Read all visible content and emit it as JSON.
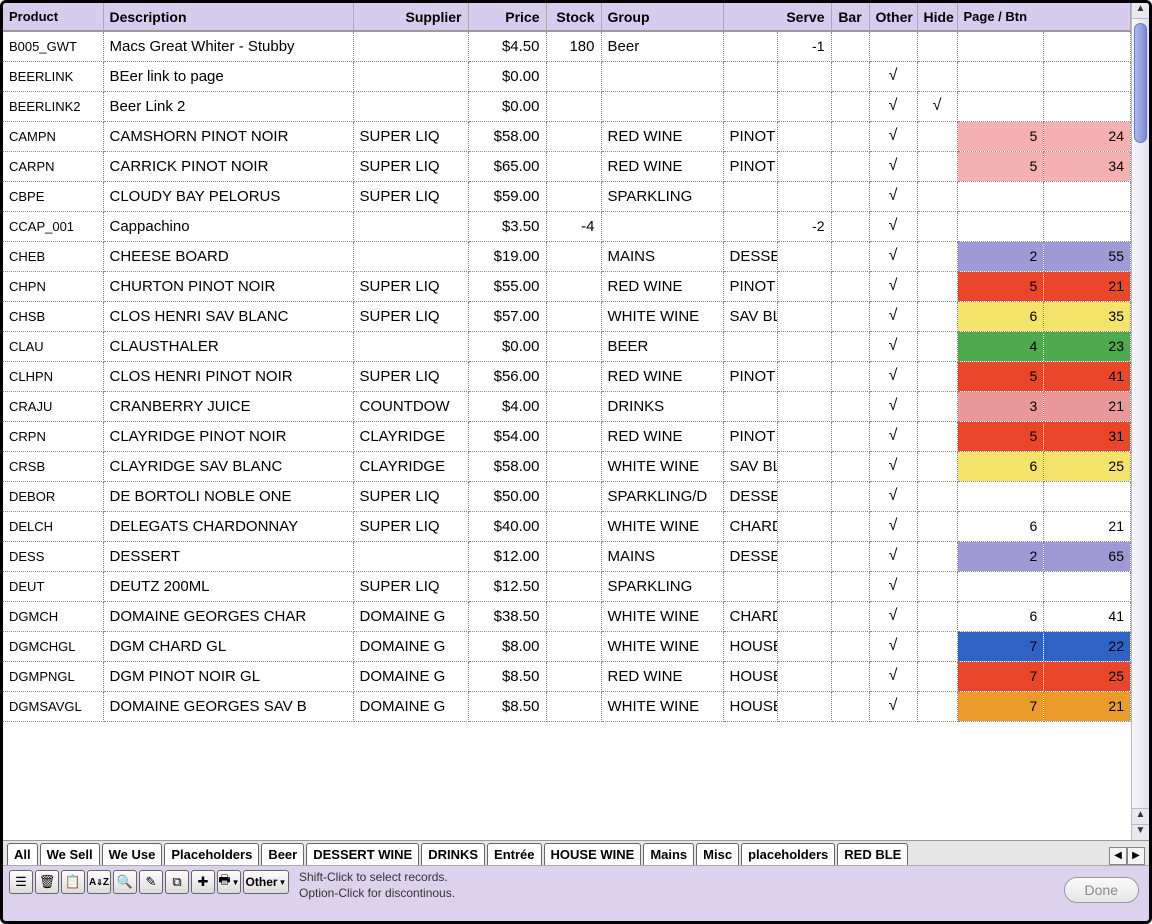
{
  "columns": {
    "product": "Product",
    "description": "Description",
    "supplier": "Supplier",
    "price": "Price",
    "stock": "Stock",
    "group": "Group",
    "serve": "Serve",
    "bar": "Bar",
    "other": "Other",
    "hide": "Hide",
    "pagebtn": "Page / Btn"
  },
  "rows": [
    {
      "product": "B005_GWT",
      "desc": "Macs Great Whiter - Stubby",
      "supp": "",
      "price": "$4.50",
      "stock": "180",
      "group": "Beer",
      "serve": "",
      "serven": "-1",
      "bar": "",
      "other": "",
      "hide": "",
      "page": "",
      "btn": "",
      "pcolor": "",
      "bcolor": ""
    },
    {
      "product": "BEERLINK",
      "desc": "BEer link to page",
      "supp": "",
      "price": "$0.00",
      "stock": "",
      "group": "",
      "serve": "",
      "serven": "",
      "bar": "",
      "other": "√",
      "hide": "",
      "page": "",
      "btn": "",
      "pcolor": "",
      "bcolor": ""
    },
    {
      "product": "BEERLINK2",
      "desc": "Beer Link 2",
      "supp": "",
      "price": "$0.00",
      "stock": "",
      "group": "",
      "serve": "",
      "serven": "",
      "bar": "",
      "other": "√",
      "hide": "√",
      "page": "",
      "btn": "",
      "pcolor": "",
      "bcolor": ""
    },
    {
      "product": "CAMPN",
      "desc": "CAMSHORN PINOT NOIR",
      "supp": "SUPER LIQ",
      "price": "$58.00",
      "stock": "",
      "group": "RED WINE",
      "serve": "PINOT NOI",
      "serven": "",
      "bar": "",
      "other": "√",
      "hide": "",
      "page": "5",
      "btn": "24",
      "pcolor": "#f5b0b0",
      "bcolor": "#f5b0b0"
    },
    {
      "product": "CARPN",
      "desc": "CARRICK PINOT NOIR",
      "supp": "SUPER LIQ",
      "price": "$65.00",
      "stock": "",
      "group": "RED WINE",
      "serve": "PINOT NOI",
      "serven": "",
      "bar": "",
      "other": "√",
      "hide": "",
      "page": "5",
      "btn": "34",
      "pcolor": "#f5b0b0",
      "bcolor": "#f5b0b0"
    },
    {
      "product": "CBPE",
      "desc": "CLOUDY BAY PELORUS",
      "supp": "SUPER LIQ",
      "price": "$59.00",
      "stock": "",
      "group": "SPARKLING",
      "serve": "",
      "serven": "",
      "bar": "",
      "other": "√",
      "hide": "",
      "page": "",
      "btn": "",
      "pcolor": "",
      "bcolor": ""
    },
    {
      "product": "CCAP_001",
      "desc": "Cappachino",
      "supp": "",
      "price": "$3.50",
      "stock": "-4",
      "group": "",
      "serve": "",
      "serven": "-2",
      "bar": "",
      "other": "√",
      "hide": "",
      "page": "",
      "btn": "",
      "pcolor": "",
      "bcolor": ""
    },
    {
      "product": "CHEB",
      "desc": "CHEESE BOARD",
      "supp": "",
      "price": "$19.00",
      "stock": "",
      "group": "MAINS",
      "serve": "DESSERT",
      "serven": "",
      "bar": "",
      "other": "√",
      "hide": "",
      "page": "2",
      "btn": "55",
      "pcolor": "#9f9ad6",
      "bcolor": "#9f9ad6"
    },
    {
      "product": "CHPN",
      "desc": "CHURTON PINOT NOIR",
      "supp": "SUPER LIQ",
      "price": "$55.00",
      "stock": "",
      "group": "RED WINE",
      "serve": "PINOT NOI",
      "serven": "",
      "bar": "",
      "other": "√",
      "hide": "",
      "page": "5",
      "btn": "21",
      "pcolor": "#e9462a",
      "bcolor": "#e9462a"
    },
    {
      "product": "CHSB",
      "desc": "CLOS HENRI SAV BLANC",
      "supp": "SUPER LIQ",
      "price": "$57.00",
      "stock": "",
      "group": "WHITE WINE",
      "serve": "SAV BLANC",
      "serven": "",
      "bar": "",
      "other": "√",
      "hide": "",
      "page": "6",
      "btn": "35",
      "pcolor": "#f3e36a",
      "bcolor": "#f3e36a"
    },
    {
      "product": "CLAU",
      "desc": "CLAUSTHALER",
      "supp": "",
      "price": "$0.00",
      "stock": "",
      "group": "BEER",
      "serve": "",
      "serven": "",
      "bar": "",
      "other": "√",
      "hide": "",
      "page": "4",
      "btn": "23",
      "pcolor": "#4fa94f",
      "bcolor": "#4fa94f"
    },
    {
      "product": "CLHPN",
      "desc": "CLOS HENRI PINOT NOIR",
      "supp": "SUPER LIQ",
      "price": "$56.00",
      "stock": "",
      "group": "RED WINE",
      "serve": "PINOT NOI",
      "serven": "",
      "bar": "",
      "other": "√",
      "hide": "",
      "page": "5",
      "btn": "41",
      "pcolor": "#e9462a",
      "bcolor": "#e9462a"
    },
    {
      "product": "CRAJU",
      "desc": "CRANBERRY JUICE",
      "supp": "COUNTDOW",
      "price": "$4.00",
      "stock": "",
      "group": "DRINKS",
      "serve": "",
      "serven": "",
      "bar": "",
      "other": "√",
      "hide": "",
      "page": "3",
      "btn": "21",
      "pcolor": "#ea9797",
      "bcolor": "#ea9797"
    },
    {
      "product": "CRPN",
      "desc": "CLAYRIDGE PINOT NOIR",
      "supp": "CLAYRIDGE",
      "price": "$54.00",
      "stock": "",
      "group": "RED WINE",
      "serve": "PINOT NOI",
      "serven": "",
      "bar": "",
      "other": "√",
      "hide": "",
      "page": "5",
      "btn": "31",
      "pcolor": "#e9462a",
      "bcolor": "#e9462a"
    },
    {
      "product": "CRSB",
      "desc": "CLAYRIDGE SAV BLANC",
      "supp": "CLAYRIDGE",
      "price": "$58.00",
      "stock": "",
      "group": "WHITE WINE",
      "serve": "SAV BLANC",
      "serven": "",
      "bar": "",
      "other": "√",
      "hide": "",
      "page": "6",
      "btn": "25",
      "pcolor": "#f3e36a",
      "bcolor": "#f3e36a"
    },
    {
      "product": "DEBOR",
      "desc": "DE BORTOLI NOBLE ONE",
      "supp": "SUPER LIQ",
      "price": "$50.00",
      "stock": "",
      "group": "SPARKLING/D",
      "serve": "DESSERT W",
      "serven": "",
      "bar": "",
      "other": "√",
      "hide": "",
      "page": "",
      "btn": "",
      "pcolor": "",
      "bcolor": ""
    },
    {
      "product": "DELCH",
      "desc": "DELEGATS CHARDONNAY",
      "supp": "SUPER LIQ",
      "price": "$40.00",
      "stock": "",
      "group": "WHITE WINE",
      "serve": "CHARDON",
      "serven": "",
      "bar": "",
      "other": "√",
      "hide": "",
      "page": "6",
      "btn": "21",
      "pcolor": "",
      "bcolor": ""
    },
    {
      "product": "DESS",
      "desc": "DESSERT",
      "supp": "",
      "price": "$12.00",
      "stock": "",
      "group": "MAINS",
      "serve": "DESSERT",
      "serven": "",
      "bar": "",
      "other": "√",
      "hide": "",
      "page": "2",
      "btn": "65",
      "pcolor": "#9f9ad6",
      "bcolor": "#9f9ad6"
    },
    {
      "product": "DEUT",
      "desc": "DEUTZ 200ML",
      "supp": "SUPER LIQ",
      "price": "$12.50",
      "stock": "",
      "group": "SPARKLING",
      "serve": "",
      "serven": "",
      "bar": "",
      "other": "√",
      "hide": "",
      "page": "",
      "btn": "",
      "pcolor": "",
      "bcolor": ""
    },
    {
      "product": "DGMCH",
      "desc": "DOMAINE GEORGES CHAR",
      "supp": "DOMAINE G",
      "price": "$38.50",
      "stock": "",
      "group": "WHITE WINE",
      "serve": "CHARDON",
      "serven": "",
      "bar": "",
      "other": "√",
      "hide": "",
      "page": "6",
      "btn": "41",
      "pcolor": "",
      "bcolor": ""
    },
    {
      "product": "DGMCHGL",
      "desc": "DGM CHARD GL",
      "supp": "DOMAINE G",
      "price": "$8.00",
      "stock": "",
      "group": "WHITE WINE",
      "serve": "HOUSE WI",
      "serven": "",
      "bar": "",
      "other": "√",
      "hide": "",
      "page": "7",
      "btn": "22",
      "pcolor": "#2e62c4",
      "bcolor": "#2e62c4"
    },
    {
      "product": "DGMPNGL",
      "desc": "DGM PINOT NOIR GL",
      "supp": "DOMAINE G",
      "price": "$8.50",
      "stock": "",
      "group": "RED WINE",
      "serve": "HOUSE WI",
      "serven": "",
      "bar": "",
      "other": "√",
      "hide": "",
      "page": "7",
      "btn": "25",
      "pcolor": "#e9462a",
      "bcolor": "#e9462a"
    },
    {
      "product": "DGMSAVGL",
      "desc": "DOMAINE GEORGES SAV B",
      "supp": "DOMAINE G",
      "price": "$8.50",
      "stock": "",
      "group": "WHITE WINE",
      "serve": "HOUSE WI",
      "serven": "",
      "bar": "",
      "other": "√",
      "hide": "",
      "page": "7",
      "btn": "21",
      "pcolor": "#eb9b2a",
      "bcolor": "#eb9b2a"
    }
  ],
  "tabs": [
    "All",
    "We Sell",
    "We Use",
    "Placeholders",
    "Beer",
    "DESSERT WINE",
    "DRINKS",
    "Entrée",
    "HOUSE WINE",
    "Mains",
    "Misc",
    "placeholders",
    "RED BLE"
  ],
  "hints": {
    "l1": "Shift-Click to select records.",
    "l2": "Option-Click for discontinous."
  },
  "toolbar": {
    "other": "Other"
  },
  "done": "Done"
}
